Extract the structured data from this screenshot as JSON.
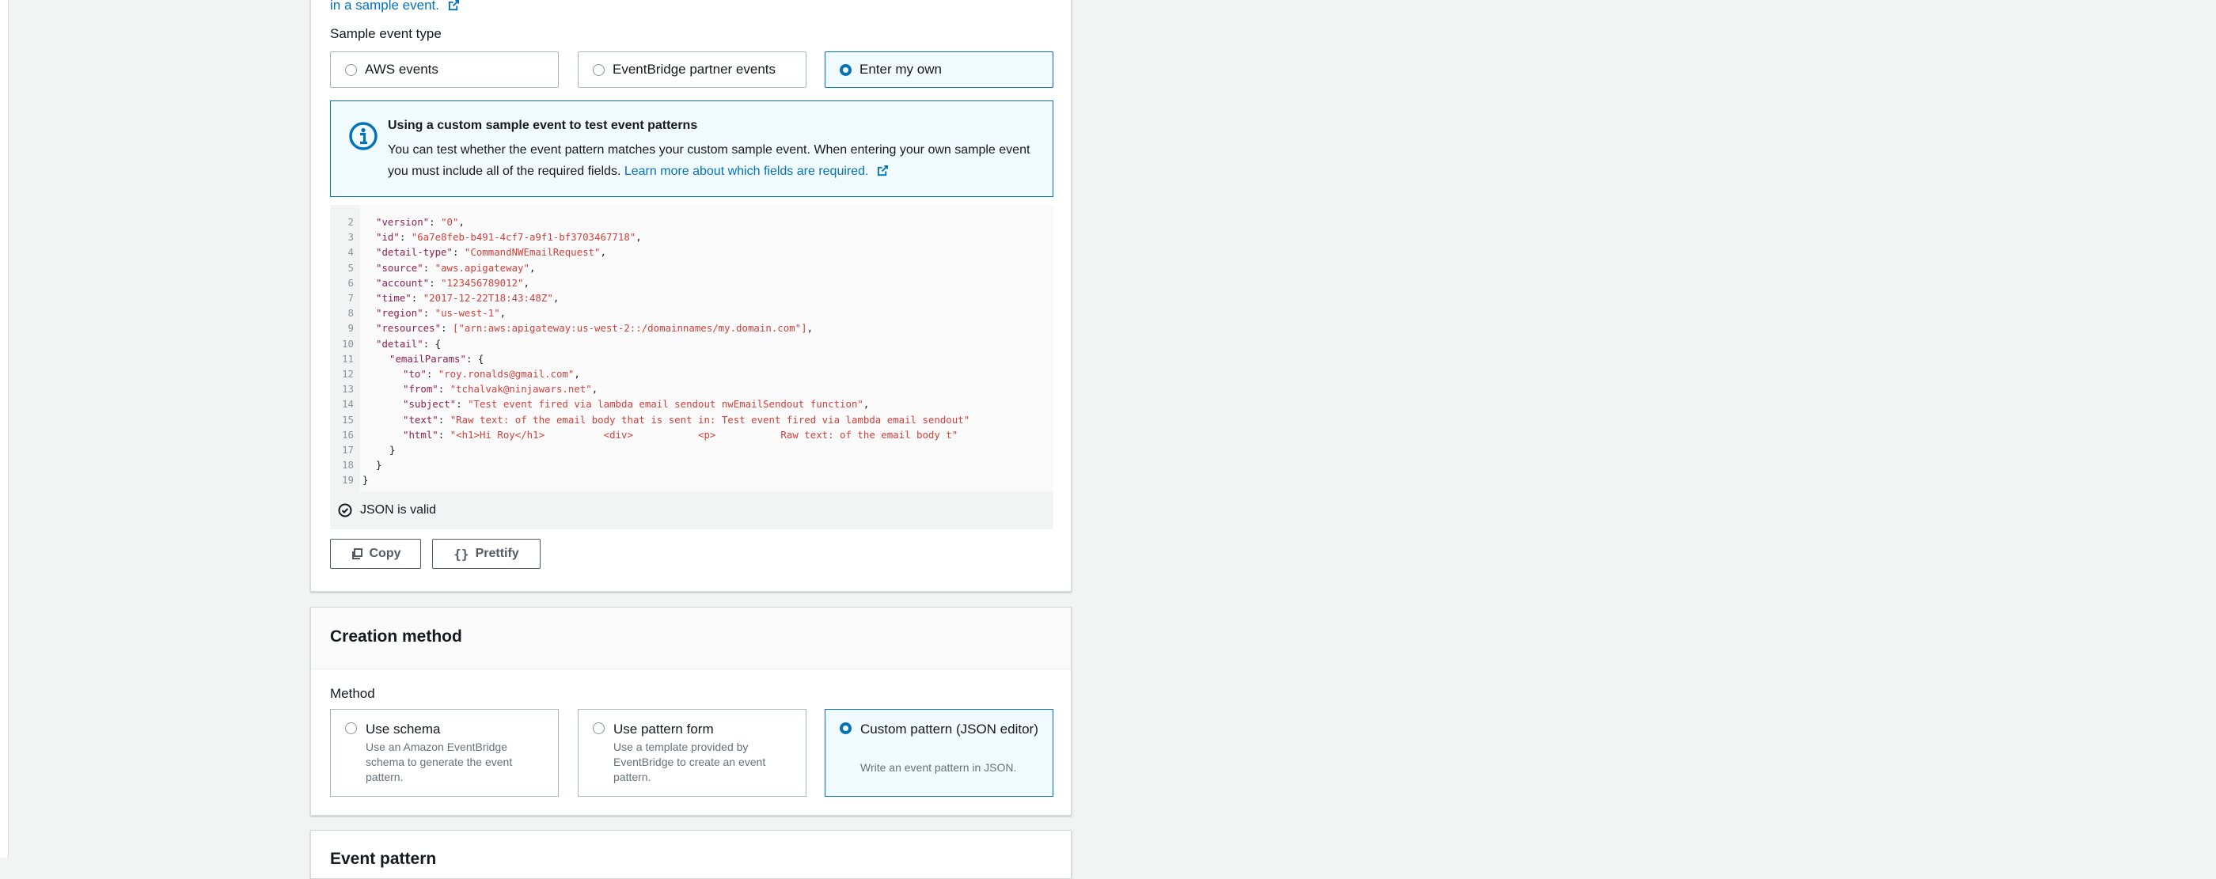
{
  "sample_event": {
    "intro_link": "in a sample event.",
    "type_label": "Sample event type",
    "options": [
      {
        "label": "AWS events",
        "selected": false
      },
      {
        "label": "EventBridge partner events",
        "selected": false
      },
      {
        "label": "Enter my own",
        "selected": true
      }
    ],
    "info": {
      "title": "Using a custom sample event to test event patterns",
      "body": "You can test whether the event pattern matches your custom sample event. When entering your own sample event you must include all of the required fields.",
      "link": "Learn more about which fields are required."
    }
  },
  "editor": {
    "lines": [
      {
        "n": "2",
        "indent": 1,
        "key": "version",
        "value": "\"0\"",
        "tail": ","
      },
      {
        "n": "3",
        "indent": 1,
        "key": "id",
        "value": "\"6a7e8feb-b491-4cf7-a9f1-bf3703467718\"",
        "tail": ","
      },
      {
        "n": "4",
        "indent": 1,
        "key": "detail-type",
        "value": "\"CommandNWEmailRequest\"",
        "tail": ","
      },
      {
        "n": "5",
        "indent": 1,
        "key": "source",
        "value": "\"aws.apigateway\"",
        "tail": ","
      },
      {
        "n": "6",
        "indent": 1,
        "key": "account",
        "value": "\"123456789012\"",
        "tail": ","
      },
      {
        "n": "7",
        "indent": 1,
        "key": "time",
        "value": "\"2017-12-22T18:43:48Z\"",
        "tail": ","
      },
      {
        "n": "8",
        "indent": 1,
        "key": "region",
        "value": "\"us-west-1\"",
        "tail": ","
      },
      {
        "n": "9",
        "indent": 1,
        "key": "resources",
        "value": "[\"arn:aws:apigateway:us-west-2::/domainnames/my.domain.com\"]",
        "tail": ","
      },
      {
        "n": "10",
        "indent": 1,
        "key": "detail",
        "value": "{",
        "tail": ""
      },
      {
        "n": "11",
        "indent": 2,
        "key": "emailParams",
        "value": "{",
        "tail": ""
      },
      {
        "n": "12",
        "indent": 3,
        "key": "to",
        "value": "\"roy.ronalds@gmail.com\"",
        "tail": ","
      },
      {
        "n": "13",
        "indent": 3,
        "key": "from",
        "value": "\"tchalvak@ninjawars.net\"",
        "tail": ","
      },
      {
        "n": "14",
        "indent": 3,
        "key": "subject",
        "value": "\"Test event fired via lambda email sendout nwEmailSendout function\"",
        "tail": ","
      },
      {
        "n": "15",
        "indent": 3,
        "key": "text",
        "value": "\"Raw text: of the email body that is sent in: Test event fired via lambda email sendout\"",
        "tail": ""
      },
      {
        "n": "16",
        "indent": 3,
        "key": "html",
        "value": "\"<h1>Hi Roy</h1>          <div>           <p>           Raw text: of the email body t\"",
        "tail": ""
      },
      {
        "n": "17",
        "indent": 2,
        "key": "",
        "value": "}",
        "tail": ""
      },
      {
        "n": "18",
        "indent": 1,
        "key": "",
        "value": "}",
        "tail": ""
      },
      {
        "n": "19",
        "indent": 0,
        "key": "",
        "value": "}",
        "tail": ""
      }
    ],
    "validity": "JSON is valid",
    "copy_label": "Copy",
    "prettify_label": "Prettify"
  },
  "creation": {
    "title": "Creation method",
    "method_label": "Method",
    "options": [
      {
        "title": "Use schema",
        "desc": "Use an Amazon EventBridge schema to generate the event pattern.",
        "selected": false
      },
      {
        "title": "Use pattern form",
        "desc": "Use a template provided by EventBridge to create an event pattern.",
        "selected": false
      },
      {
        "title": "Custom pattern (JSON editor)",
        "desc": "Write an event pattern in JSON.",
        "selected": true
      }
    ]
  },
  "next_section": {
    "title": "Event pattern"
  },
  "colors": {
    "accent": "#0073bb",
    "selected_bg": "#f1faff",
    "json_string": "#d0413c"
  }
}
